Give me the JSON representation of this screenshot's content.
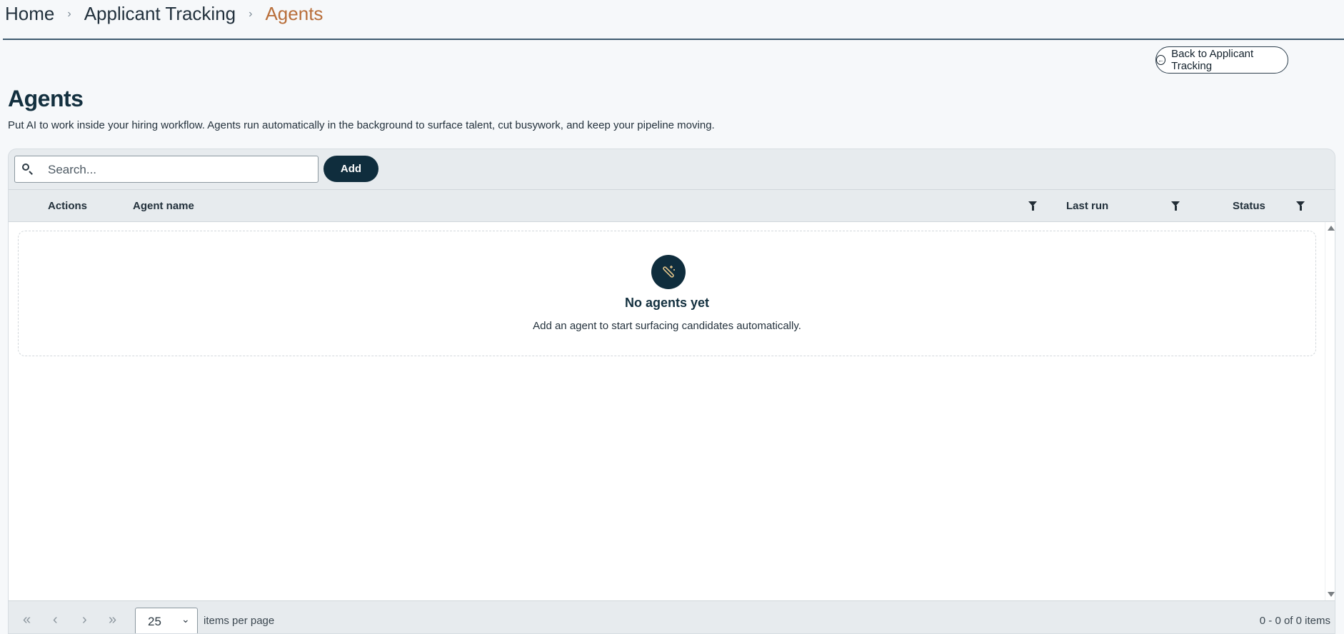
{
  "breadcrumb": {
    "items": [
      "Home",
      "Applicant Tracking"
    ],
    "current": "Agents",
    "separator": "›"
  },
  "back_button": {
    "label": "Back to Applicant Tracking",
    "icon": "arrow-left-circle-icon"
  },
  "page": {
    "title": "Agents",
    "description": "Put AI to work inside your hiring workflow. Agents run automatically in the background to surface talent, cut busywork, and keep your pipeline moving."
  },
  "toolbar": {
    "search_placeholder": "Search...",
    "search_value": "",
    "add_label": "Add"
  },
  "grid": {
    "columns": [
      "Actions",
      "Agent name",
      "Last run",
      "Status"
    ]
  },
  "empty_state": {
    "icon": "magic-wand-icon",
    "title": "No agents yet",
    "text": "Add an agent to start surfacing candidates automatically."
  },
  "pager": {
    "page_size": "25",
    "per_page_label": "items per page",
    "count_text": "0 - 0 of 0 items"
  },
  "colors": {
    "accent": "#0f2d3d",
    "breadcrumb_current": "#b86e3a"
  }
}
